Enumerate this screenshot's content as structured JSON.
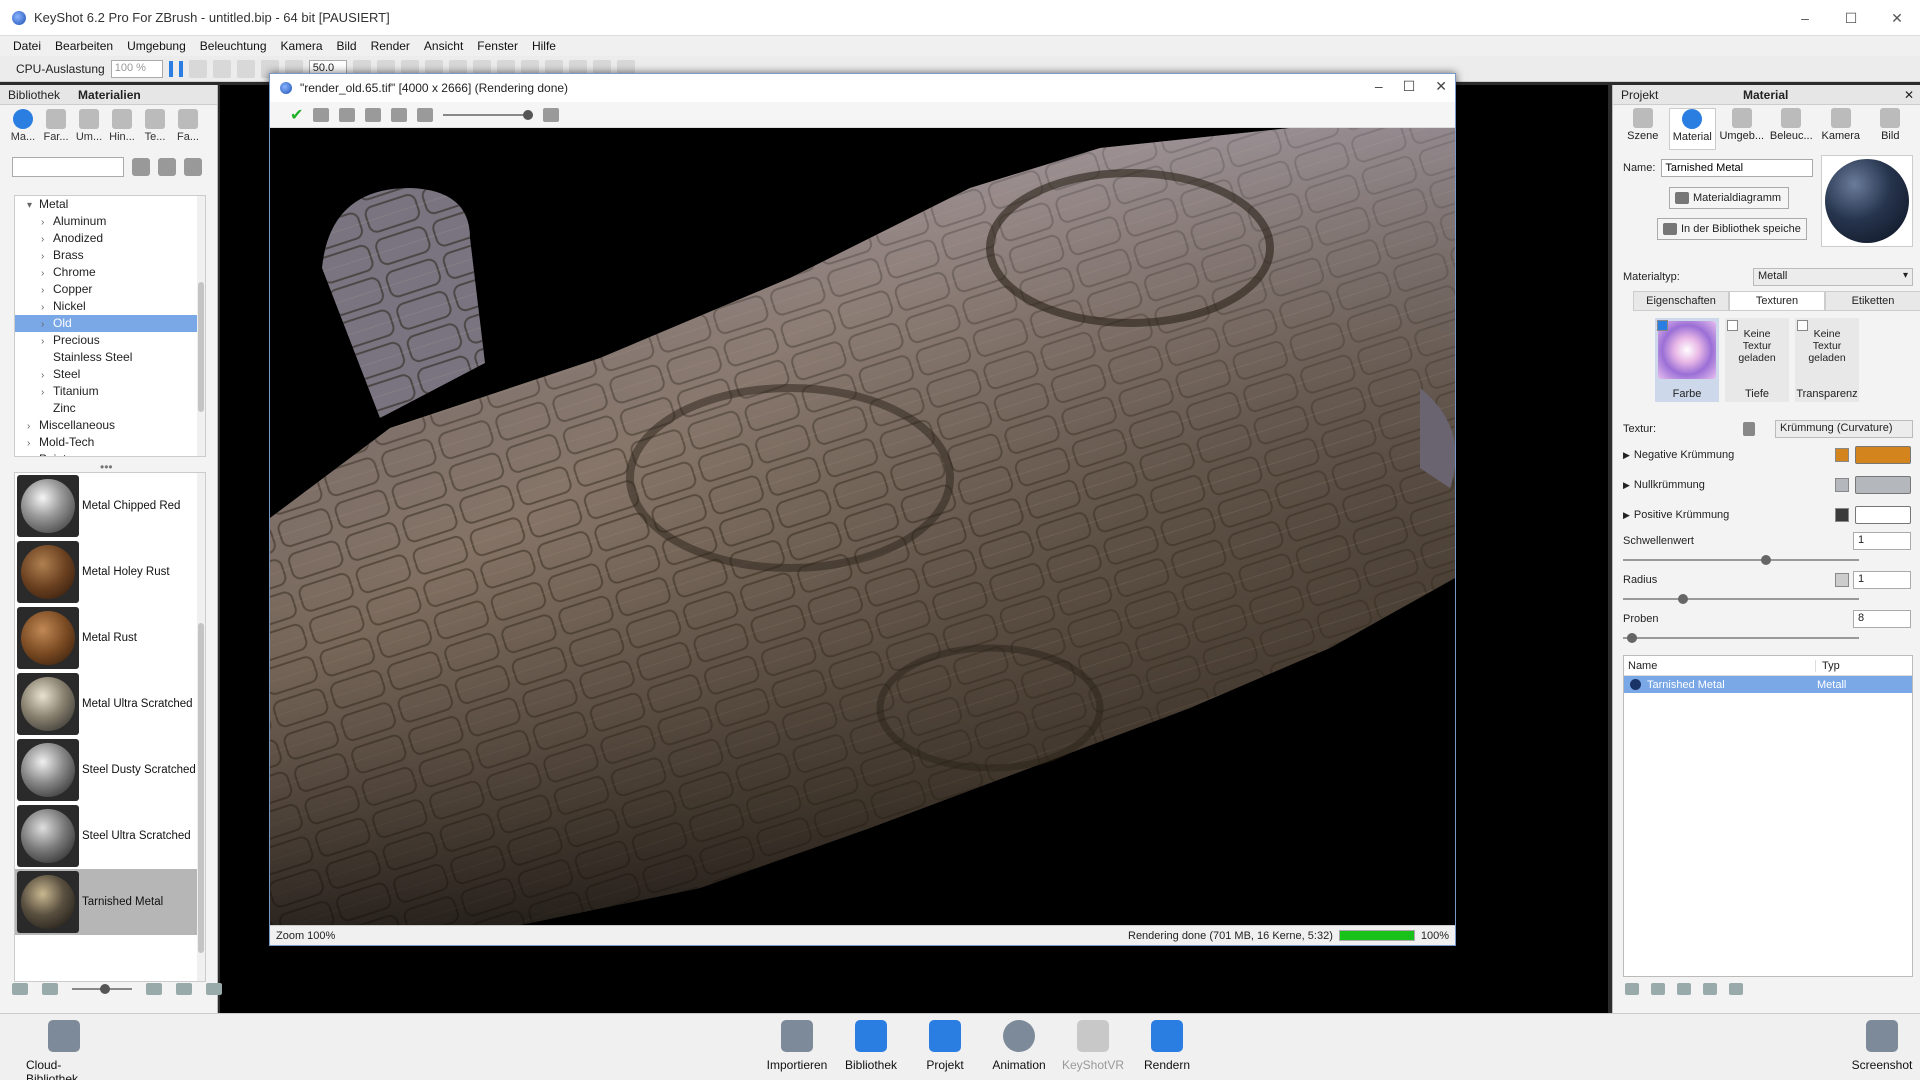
{
  "window": {
    "title": "KeyShot 6.2 Pro For ZBrush - untitled.bip - 64 bit [PAUSIERT]",
    "controls": [
      "–",
      "☐",
      "✕"
    ]
  },
  "menu": [
    "Datei",
    "Bearbeiten",
    "Umgebung",
    "Beleuchtung",
    "Kamera",
    "Bild",
    "Render",
    "Ansicht",
    "Fenster",
    "Hilfe"
  ],
  "toolbar": {
    "cpu_label": "CPU-Auslastung",
    "cpu_value": "100 %",
    "zoom_value": "50.0"
  },
  "library": {
    "title": "Bibliothek",
    "active": "Materialien",
    "tabs": [
      "Ma...",
      "Far...",
      "Um...",
      "Hin...",
      "Te...",
      "Fa..."
    ],
    "search_placeholder": "",
    "tree": [
      {
        "label": "Metal",
        "level": 1,
        "expanded": true
      },
      {
        "label": "Aluminum",
        "level": 2
      },
      {
        "label": "Anodized",
        "level": 2
      },
      {
        "label": "Brass",
        "level": 2
      },
      {
        "label": "Chrome",
        "level": 2
      },
      {
        "label": "Copper",
        "level": 2
      },
      {
        "label": "Nickel",
        "level": 2
      },
      {
        "label": "Old",
        "level": 2,
        "selected": true
      },
      {
        "label": "Precious",
        "level": 2
      },
      {
        "label": "Stainless Steel",
        "level": 2,
        "leaf": true
      },
      {
        "label": "Steel",
        "level": 2
      },
      {
        "label": "Titanium",
        "level": 2
      },
      {
        "label": "Zinc",
        "level": 2,
        "leaf": true
      },
      {
        "label": "Miscellaneous",
        "level": 1
      },
      {
        "label": "Mold-Tech",
        "level": 1
      },
      {
        "label": "Paint",
        "level": 1
      }
    ],
    "materials": [
      {
        "name": "Metal Chipped Red",
        "style": "chrome"
      },
      {
        "name": "Metal Holey Rust",
        "style": "rust-holey"
      },
      {
        "name": "Metal Rust",
        "style": "rust"
      },
      {
        "name": "Metal Ultra Scratched",
        "style": "scratched"
      },
      {
        "name": "Steel Dusty Scratched",
        "style": "steel"
      },
      {
        "name": "Steel Ultra Scratched",
        "style": "steel2"
      },
      {
        "name": "Tarnished Metal",
        "style": "tarnished",
        "selected": true
      }
    ]
  },
  "render_window": {
    "title": "\"render_old.65.tif\" [4000 x 2666] (Rendering done)",
    "zoom": "Zoom 100%",
    "status": "Rendering done (701 MB, 16 Kerne, 5:32)",
    "progress_label": "100%",
    "progress": 100
  },
  "project": {
    "title": "Projekt",
    "section": "Material",
    "tabs": [
      "Szene",
      "Material",
      "Umgeb...",
      "Beleuc...",
      "Kamera",
      "Bild"
    ],
    "active_tab": 1,
    "name_label": "Name:",
    "name_value": "Tarnished Metal",
    "btn_diagram": "Materialdiagramm",
    "btn_save": "In der Bibliothek speiche",
    "mtype_label": "Materialtyp:",
    "mtype_value": "Metall",
    "subtabs": [
      "Eigenschaften",
      "Texturen",
      "Etiketten"
    ],
    "active_subtab": 1,
    "slots": [
      {
        "caption": "Farbe",
        "text": "",
        "checked": true
      },
      {
        "caption": "Tiefe",
        "text": "Keine Textur geladen",
        "checked": false
      },
      {
        "caption": "Transparenz",
        "text": "Keine Textur geladen",
        "checked": false
      }
    ],
    "texture_label": "Textur:",
    "texture_value": "Krümmung (Curvature)",
    "curvatures": [
      {
        "label": "Negative Krümmung",
        "color": "#d4841c"
      },
      {
        "label": "Nullkrümmung",
        "color": "#b4b8bc"
      },
      {
        "label": "Positive Krümmung",
        "color": "#3a3a3a"
      }
    ],
    "threshold_label": "Schwellenwert",
    "threshold_value": "1",
    "radius_label": "Radius",
    "radius_value": "1",
    "samples_label": "Proben",
    "samples_value": "8",
    "table_header": [
      "Name",
      "Typ"
    ],
    "table_rows": [
      {
        "name": "Tarnished Metal",
        "type": "Metall"
      }
    ]
  },
  "dock": [
    {
      "label": "Cloud-Bibliothek",
      "state": "normal"
    },
    {
      "label": "Importieren",
      "state": "normal"
    },
    {
      "label": "Bibliothek",
      "state": "blue"
    },
    {
      "label": "Projekt",
      "state": "blue"
    },
    {
      "label": "Animation",
      "state": "normal"
    },
    {
      "label": "KeyShotVR",
      "state": "disabled"
    },
    {
      "label": "Rendern",
      "state": "blue"
    },
    {
      "label": "Screenshot",
      "state": "normal"
    }
  ]
}
